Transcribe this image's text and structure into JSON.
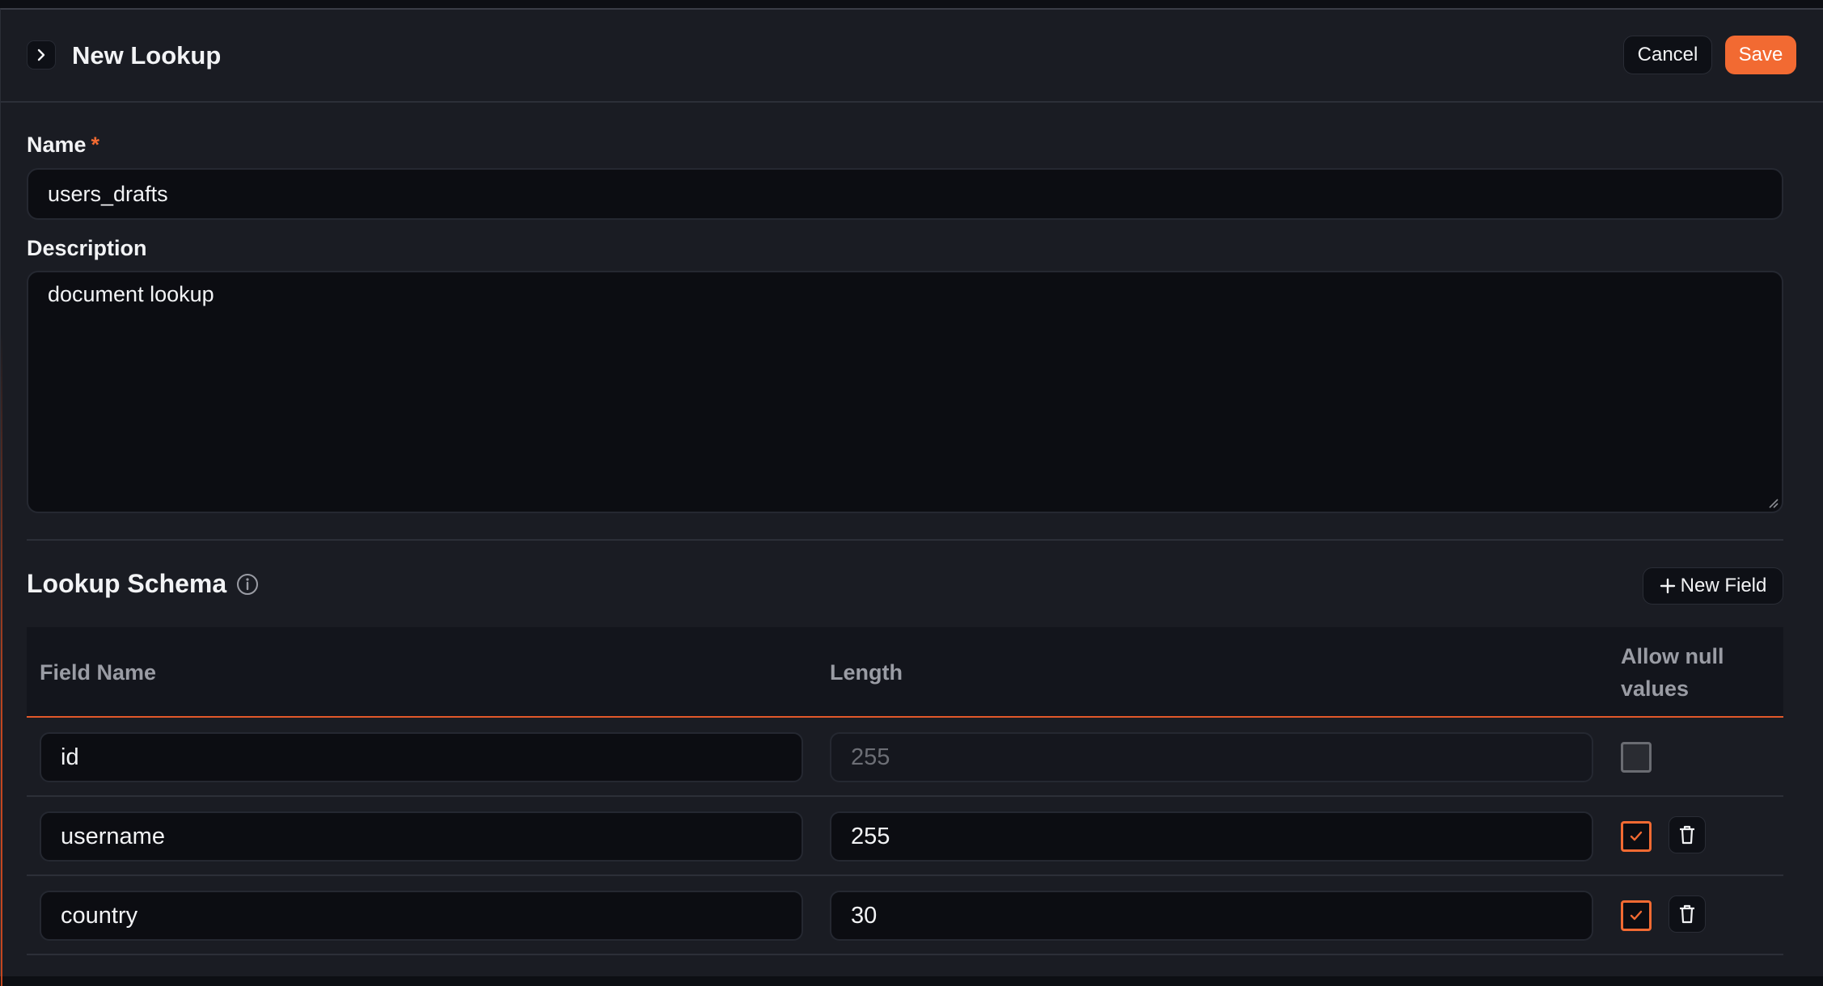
{
  "header": {
    "title": "New Lookup",
    "cancel_label": "Cancel",
    "save_label": "Save"
  },
  "form": {
    "name_label": "Name",
    "required_mark": "*",
    "name_value": "users_drafts",
    "description_label": "Description",
    "description_value": "document lookup"
  },
  "schema": {
    "title": "Lookup Schema",
    "new_field_label": "New Field",
    "columns": {
      "field_name": "Field Name",
      "length": "Length",
      "allow_null": "Allow null values"
    },
    "rows": [
      {
        "field_name": "id",
        "length": "255",
        "allow_null": false,
        "deletable": false
      },
      {
        "field_name": "username",
        "length": "255",
        "allow_null": true,
        "deletable": true
      },
      {
        "field_name": "country",
        "length": "30",
        "allow_null": true,
        "deletable": true
      }
    ]
  },
  "colors": {
    "accent": "#f26a32",
    "background": "#1a1c23"
  },
  "icons": [
    "chevron-right-icon",
    "info-icon",
    "plus-icon",
    "check-icon",
    "trash-icon"
  ]
}
